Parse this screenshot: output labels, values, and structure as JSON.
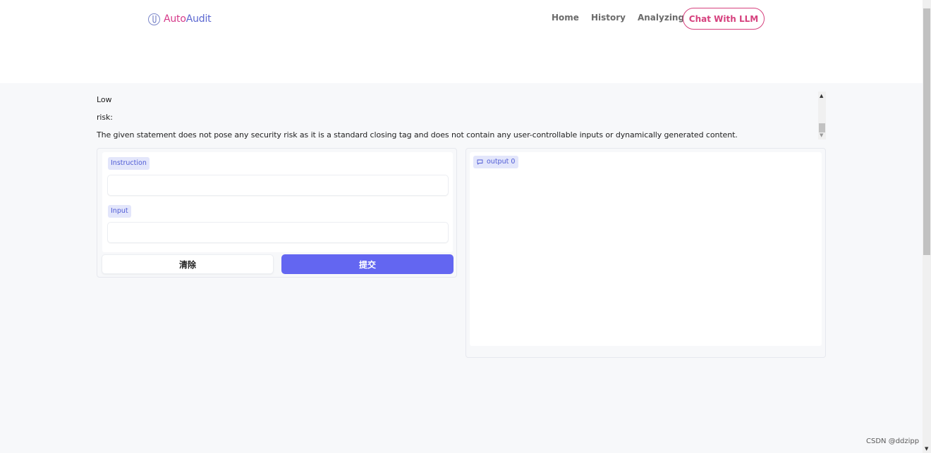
{
  "header": {
    "logo_part1": "Auto",
    "logo_part2": "Audit",
    "nav": [
      "Home",
      "History",
      "Analyzing"
    ],
    "chat_button": "Chat With LLM"
  },
  "output_text": {
    "line1": "Low",
    "line2": "risk:",
    "line3": "The given statement does not pose any security risk as it is a standard closing tag and does not contain any user-controllable inputs or dynamically generated content."
  },
  "form": {
    "instruction_label": "Instruction",
    "instruction_value": "",
    "input_label": "Input",
    "input_value": "",
    "clear_button": "清除",
    "submit_button": "提交"
  },
  "output_panel": {
    "label": "output 0"
  },
  "watermark": "CSDN @ddzipp",
  "colors": {
    "accent": "#6366f1",
    "brand_pink": "#d6417e",
    "brand_blue": "#5b67d1",
    "chip_bg": "#e3e6fb"
  }
}
